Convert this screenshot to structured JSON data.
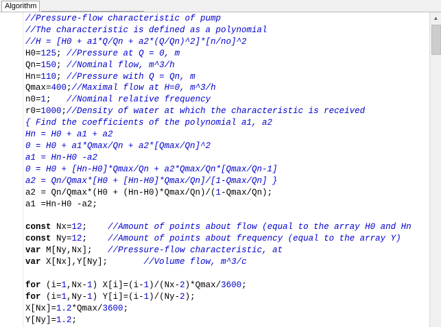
{
  "panel": {
    "title": "Algorithm"
  },
  "code": {
    "lines": [
      [
        {
          "t": "cm",
          "v": "//Pressure-flow characteristic of pump"
        }
      ],
      [
        {
          "t": "cm",
          "v": "//The characteristic is defined as a polynomial"
        }
      ],
      [
        {
          "t": "cm",
          "v": "//H = [H0 + a1*Q/Qn + a2*(Q/Qn)^2]*[n/no]^2"
        }
      ],
      [
        {
          "t": "txt",
          "v": "H0="
        },
        {
          "t": "num",
          "v": "125"
        },
        {
          "t": "txt",
          "v": "; "
        },
        {
          "t": "cm",
          "v": "//Pressure at Q = 0, m"
        }
      ],
      [
        {
          "t": "txt",
          "v": "Qn="
        },
        {
          "t": "num",
          "v": "150"
        },
        {
          "t": "txt",
          "v": "; "
        },
        {
          "t": "cm",
          "v": "//Nominal flow, m^3/h"
        }
      ],
      [
        {
          "t": "txt",
          "v": "Hn="
        },
        {
          "t": "num",
          "v": "110"
        },
        {
          "t": "txt",
          "v": "; "
        },
        {
          "t": "cm",
          "v": "//Pressure with Q = Qn, m"
        }
      ],
      [
        {
          "t": "txt",
          "v": "Qmax="
        },
        {
          "t": "num",
          "v": "400"
        },
        {
          "t": "txt",
          "v": ";"
        },
        {
          "t": "cm",
          "v": "//Maximal flow at H=0, m^3/h"
        }
      ],
      [
        {
          "t": "txt",
          "v": "n0="
        },
        {
          "t": "num",
          "v": "1"
        },
        {
          "t": "txt",
          "v": ";   "
        },
        {
          "t": "cm",
          "v": "//Nominal relative frequency"
        }
      ],
      [
        {
          "t": "txt",
          "v": "r0="
        },
        {
          "t": "num",
          "v": "1000"
        },
        {
          "t": "txt",
          "v": ";"
        },
        {
          "t": "cm",
          "v": "//Density of water at which the characteristic is received"
        }
      ],
      [
        {
          "t": "cm",
          "v": "{ Find the coefficients of the polynomial a1, a2"
        }
      ],
      [
        {
          "t": "cm",
          "v": "Hn = H0 + a1 + a2"
        }
      ],
      [
        {
          "t": "cm",
          "v": "0 = H0 + a1*Qmax/Qn + a2*[Qmax/Qn]^2"
        }
      ],
      [
        {
          "t": "cm",
          "v": "a1 = Hn-H0 -a2"
        }
      ],
      [
        {
          "t": "cm",
          "v": "0 = H0 + [Hn-H0]*Qmax/Qn + a2*Qmax/Qn*[Qmax/Qn-1]"
        }
      ],
      [
        {
          "t": "cm",
          "v": "a2 = Qn/Qmax*[H0 + [Hn-H0]*Qmax/Qn]/[1-Qmax/Qn] }"
        }
      ],
      [
        {
          "t": "txt",
          "v": "a2 = Qn/Qmax*(H0 + (Hn-H0)*Qmax/Qn)/("
        },
        {
          "t": "num",
          "v": "1"
        },
        {
          "t": "txt",
          "v": "-Qmax/Qn);"
        }
      ],
      [
        {
          "t": "txt",
          "v": "a1 =Hn-H0 -a2;"
        }
      ],
      [
        {
          "t": "txt",
          "v": ""
        }
      ],
      [
        {
          "t": "kw",
          "v": "const"
        },
        {
          "t": "txt",
          "v": " Nx="
        },
        {
          "t": "num",
          "v": "12"
        },
        {
          "t": "txt",
          "v": ";    "
        },
        {
          "t": "cm",
          "v": "//Amount of points about flow (equal to the array H0 and Hn"
        }
      ],
      [
        {
          "t": "kw",
          "v": "const"
        },
        {
          "t": "txt",
          "v": " Ny="
        },
        {
          "t": "num",
          "v": "12"
        },
        {
          "t": "txt",
          "v": ";    "
        },
        {
          "t": "cm",
          "v": "//Amount of points about frequency (equal to the array Y)"
        }
      ],
      [
        {
          "t": "kw",
          "v": "var"
        },
        {
          "t": "txt",
          "v": " M[Ny,Nx];   "
        },
        {
          "t": "cm",
          "v": "//Pressure-flow characteristic, at"
        }
      ],
      [
        {
          "t": "kw",
          "v": "var"
        },
        {
          "t": "txt",
          "v": " X[Nx],Y[Ny];       "
        },
        {
          "t": "cm",
          "v": "//Volume flow, m^3/c"
        }
      ],
      [
        {
          "t": "txt",
          "v": ""
        }
      ],
      [
        {
          "t": "kw",
          "v": "for"
        },
        {
          "t": "txt",
          "v": " (i="
        },
        {
          "t": "num",
          "v": "1"
        },
        {
          "t": "txt",
          "v": ",Nx-"
        },
        {
          "t": "num",
          "v": "1"
        },
        {
          "t": "txt",
          "v": ") X[i]=(i-"
        },
        {
          "t": "num",
          "v": "1"
        },
        {
          "t": "txt",
          "v": ")/(Nx-"
        },
        {
          "t": "num",
          "v": "2"
        },
        {
          "t": "txt",
          "v": ")*Qmax/"
        },
        {
          "t": "num",
          "v": "3600"
        },
        {
          "t": "txt",
          "v": ";"
        }
      ],
      [
        {
          "t": "kw",
          "v": "for"
        },
        {
          "t": "txt",
          "v": " (i="
        },
        {
          "t": "num",
          "v": "1"
        },
        {
          "t": "txt",
          "v": ",Ny-"
        },
        {
          "t": "num",
          "v": "1"
        },
        {
          "t": "txt",
          "v": ") Y[i]=(i-"
        },
        {
          "t": "num",
          "v": "1"
        },
        {
          "t": "txt",
          "v": ")/(Ny-"
        },
        {
          "t": "num",
          "v": "2"
        },
        {
          "t": "txt",
          "v": ");"
        }
      ],
      [
        {
          "t": "txt",
          "v": "X[Nx]="
        },
        {
          "t": "num",
          "v": "1.2"
        },
        {
          "t": "txt",
          "v": "*Qmax/"
        },
        {
          "t": "num",
          "v": "3600"
        },
        {
          "t": "txt",
          "v": ";"
        }
      ],
      [
        {
          "t": "txt",
          "v": "Y[Ny]="
        },
        {
          "t": "num",
          "v": "1.2"
        },
        {
          "t": "txt",
          "v": ";"
        }
      ]
    ]
  },
  "scrollbar": {
    "up_icon": "triangle-up-icon"
  }
}
